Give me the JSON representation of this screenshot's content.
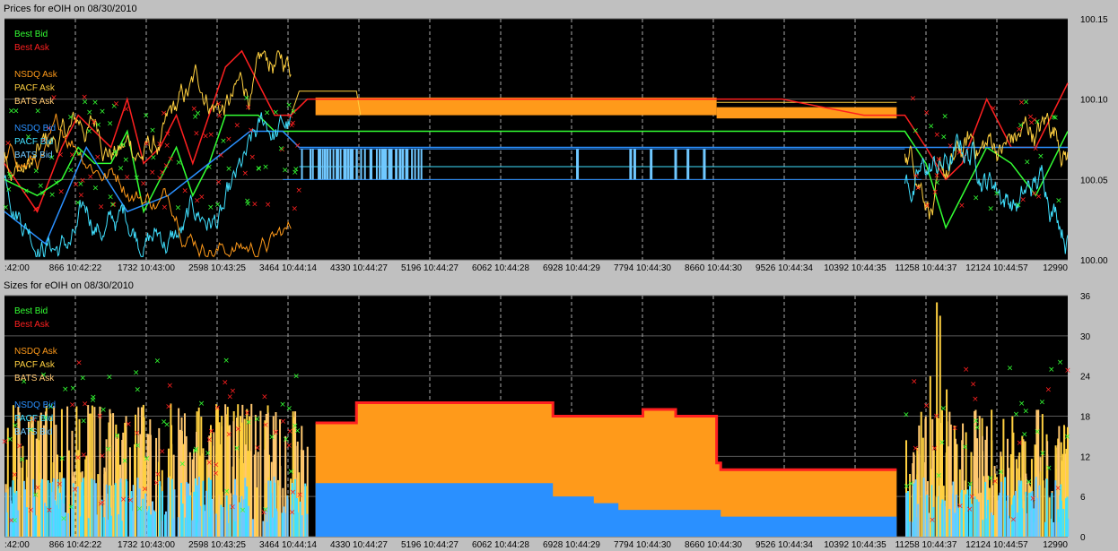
{
  "window": {
    "price_title": "Prices for  eOIH  on  08/30/2010",
    "size_title": "Sizes for  eOIH  on  08/30/2010"
  },
  "colors": {
    "best_bid": "#33ff33",
    "best_ask": "#ff2020",
    "nsdq_ask": "#ff9a1a",
    "pacf_ask": "#ffd040",
    "bats_ask": "#ffc870",
    "nsdq_bid": "#2a90ff",
    "pacf_bid": "#40e0ff",
    "bats_bid": "#70c8ff",
    "background": "#000000",
    "grid": "#777777"
  },
  "chart_data": [
    {
      "type": "line",
      "name": "prices",
      "title": "Prices for  eOIH  on  08/30/2010",
      "legend_position": "top-left",
      "legend": [
        {
          "label": "Best Bid",
          "color": "#33ff33"
        },
        {
          "label": "Best Ask",
          "color": "#ff2020"
        },
        {
          "label": "NSDQ Ask",
          "color": "#ff9a1a"
        },
        {
          "label": "PACF Ask",
          "color": "#ffd040"
        },
        {
          "label": "BATS Ask",
          "color": "#ffc870"
        },
        {
          "label": "NSDQ Bid",
          "color": "#2a90ff"
        },
        {
          "label": "PACF Bid",
          "color": "#40e0ff"
        },
        {
          "label": "BATS Bid",
          "color": "#70c8ff"
        }
      ],
      "xlim": [
        0,
        12990
      ],
      "x_tick_labels": [
        ":42:00",
        "866 10:42:22",
        "1732 10:43:00",
        "2598 10:43:25",
        "3464 10:44:14",
        "4330 10:44:27",
        "5196 10:44:27",
        "6062 10:44:28",
        "6928 10:44:29",
        "7794 10:44:30",
        "8660 10:44:30",
        "9526 10:44:34",
        "10392 10:44:35",
        "11258 10:44:37",
        "12124 10:44:57",
        "12990"
      ],
      "ylim": [
        100.0,
        100.15
      ],
      "y_ticks": [
        "100.15",
        "100.10",
        "100.05",
        "100.00"
      ],
      "y_tick_values": [
        100.15,
        100.1,
        100.05,
        100.0
      ],
      "series": [
        {
          "name": "Best Ask",
          "x": [
            0,
            400,
            700,
            900,
            1100,
            1300,
            1500,
            1700,
            1900,
            2100,
            2300,
            2500,
            2700,
            2900,
            3100,
            3300,
            3500,
            3700,
            4000,
            5000,
            6000,
            7000,
            8000,
            8600,
            8700,
            9500,
            10500,
            11000,
            11258,
            11500,
            11700,
            12000,
            12300,
            12600,
            12990
          ],
          "y": [
            100.06,
            100.03,
            100.07,
            100.09,
            100.08,
            100.07,
            100.1,
            100.06,
            100.07,
            100.09,
            100.06,
            100.09,
            100.12,
            100.13,
            100.11,
            100.09,
            100.09,
            100.1,
            100.1,
            100.1,
            100.1,
            100.1,
            100.1,
            100.1,
            100.1,
            100.1,
            100.09,
            100.09,
            100.07,
            100.05,
            100.06,
            100.1,
            100.07,
            100.07,
            100.11
          ]
        },
        {
          "name": "Best Bid",
          "x": [
            0,
            400,
            700,
            900,
            1100,
            1300,
            1500,
            1700,
            1900,
            2100,
            2300,
            2500,
            2700,
            2900,
            3100,
            3300,
            3500,
            3700,
            4000,
            5000,
            6000,
            7000,
            8000,
            8600,
            8700,
            9500,
            10500,
            11000,
            11258,
            11500,
            11700,
            12000,
            12300,
            12600,
            12990
          ],
          "y": [
            100.05,
            100.04,
            100.05,
            100.07,
            100.06,
            100.06,
            100.08,
            100.03,
            100.05,
            100.07,
            100.04,
            100.06,
            100.09,
            100.09,
            100.09,
            100.08,
            100.08,
            100.08,
            100.08,
            100.08,
            100.08,
            100.08,
            100.08,
            100.08,
            100.08,
            100.08,
            100.08,
            100.08,
            100.06,
            100.02,
            100.04,
            100.07,
            100.06,
            100.04,
            100.08
          ]
        },
        {
          "name": "NSDQ Bid",
          "x": [
            0,
            500,
            1000,
            1500,
            2000,
            2500,
            3000,
            3400,
            3600,
            12990
          ],
          "y": [
            100.03,
            100.01,
            100.07,
            100.03,
            100.04,
            100.06,
            100.08,
            100.08,
            100.07,
            100.07
          ]
        }
      ]
    },
    {
      "type": "area",
      "name": "sizes",
      "title": "Sizes for  eOIH  on  08/30/2010",
      "legend_position": "top-left",
      "legend": [
        {
          "label": "Best Bid",
          "color": "#33ff33"
        },
        {
          "label": "Best Ask",
          "color": "#ff2020"
        },
        {
          "label": "NSDQ Ask",
          "color": "#ff9a1a"
        },
        {
          "label": "PACF Ask",
          "color": "#ffd040"
        },
        {
          "label": "BATS Ask",
          "color": "#ffc870"
        },
        {
          "label": "NSDQ Bid",
          "color": "#2a90ff"
        },
        {
          "label": "PACF Bid",
          "color": "#40e0ff"
        },
        {
          "label": "BATS Bid",
          "color": "#70c8ff"
        }
      ],
      "xlim": [
        0,
        12990
      ],
      "x_tick_labels": [
        ":42:00",
        "866 10:42:22",
        "1732 10:43:00",
        "2598 10:43:25",
        "3464 10:44:14",
        "4330 10:44:27",
        "5196 10:44:27",
        "6062 10:44:28",
        "6928 10:44:29",
        "7794 10:44:30",
        "8660 10:44:30",
        "9526 10:44:34",
        "10392 10:44:35",
        "11258 10:44:37",
        "12124 10:44:57",
        "12990"
      ],
      "ylim": [
        0,
        36
      ],
      "y_ticks": [
        "36",
        "30",
        "24",
        "18",
        "12",
        "6",
        "0"
      ],
      "y_tick_values": [
        36,
        30,
        24,
        18,
        12,
        6,
        0
      ],
      "series": [
        {
          "name": "Best Ask",
          "x": [
            3800,
            4250,
            4300,
            6600,
            6700,
            7600,
            7800,
            8200,
            8700,
            8750,
            9000,
            10800,
            10900
          ],
          "y": [
            17,
            17,
            20,
            20,
            18,
            18,
            19,
            18,
            11,
            10,
            10,
            10,
            10
          ]
        },
        {
          "name": "NSDQ Bid",
          "x": [
            3800,
            4300,
            6600,
            6700,
            7200,
            7500,
            8700,
            8750,
            10900
          ],
          "y": [
            8,
            8,
            8,
            6,
            5,
            4,
            4,
            3,
            3
          ]
        }
      ]
    }
  ]
}
